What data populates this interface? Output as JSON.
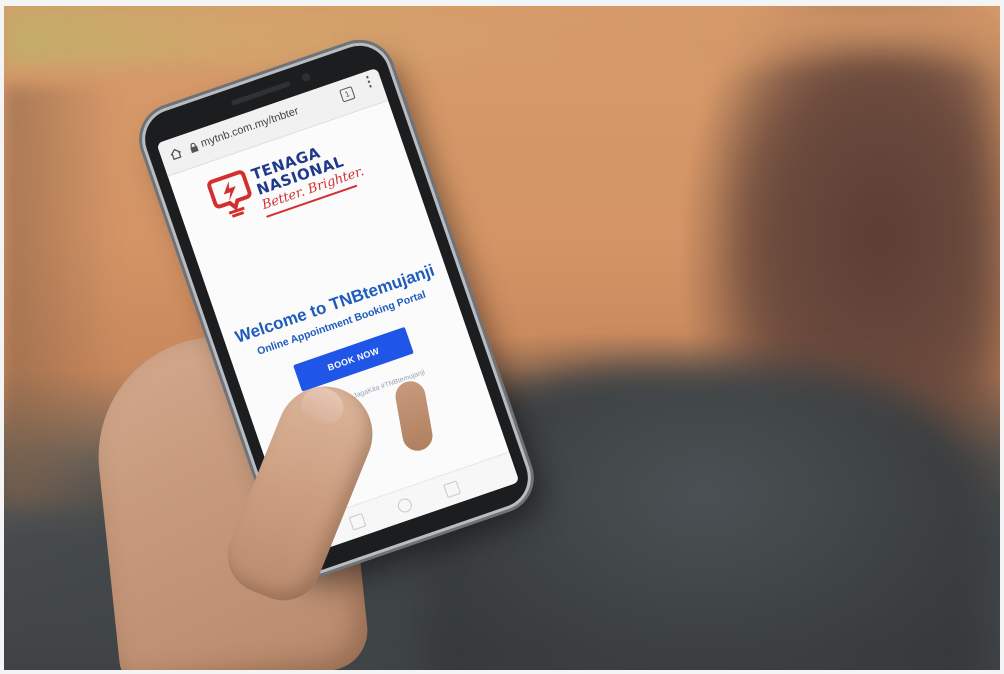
{
  "phone": {
    "browser": {
      "url": "mytnb.com.my/tnbter",
      "tab_count": "1",
      "menu": "⋮"
    },
    "logo": {
      "line1": "TENAGA",
      "line2": "NASIONAL",
      "tagline": "Better. Brighter."
    },
    "page": {
      "welcome": "Welcome to TNBtemujanji",
      "subtitle": "Online Appointment Booking Portal",
      "button_label": "BOOK NOW",
      "hashtags": "#StaySafe #KitaJagaKita #TNBtemujanji"
    }
  },
  "colors": {
    "brand_blue": "#1f3a8a",
    "brand_red": "#d32f2f",
    "button_blue": "#1f56e8",
    "heading_blue": "#1e5bbf"
  }
}
